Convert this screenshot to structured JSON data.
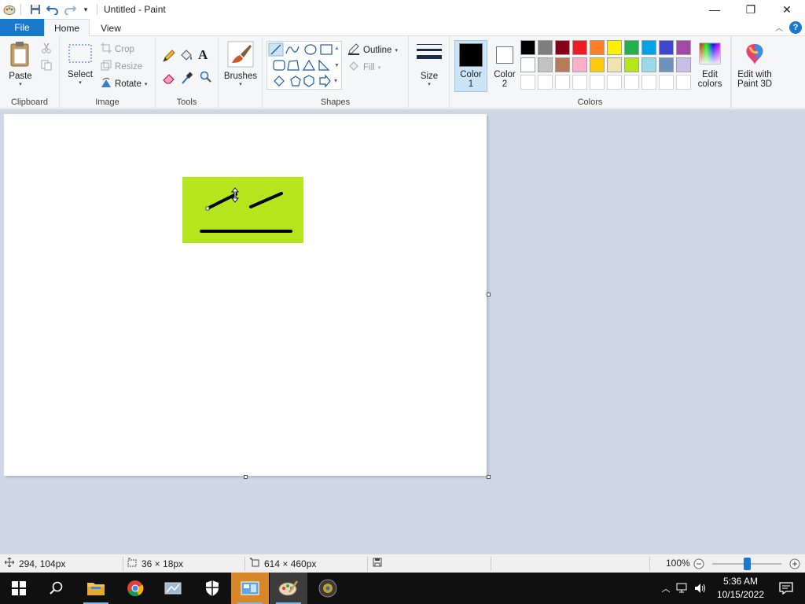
{
  "window": {
    "title": "Untitled - Paint",
    "minimize": "—",
    "maximize": "❐",
    "close": "✕"
  },
  "tabs": {
    "file": "File",
    "home": "Home",
    "view": "View"
  },
  "ribbon": {
    "clipboard": {
      "paste": "Paste",
      "label": "Clipboard"
    },
    "image": {
      "select": "Select",
      "crop": "Crop",
      "resize": "Resize",
      "rotate": "Rotate",
      "label": "Image"
    },
    "tools": {
      "label": "Tools"
    },
    "brushes": {
      "label": "Brushes"
    },
    "shapes": {
      "outline": "Outline",
      "fill": "Fill",
      "label": "Shapes"
    },
    "size": {
      "label": "Size"
    },
    "colors": {
      "color1": "Color",
      "color1_num": "1",
      "color2": "Color",
      "color2_num": "2",
      "edit_colors_1": "Edit",
      "edit_colors_2": "colors",
      "paint3d_1": "Edit with",
      "paint3d_2": "Paint 3D",
      "label": "Colors",
      "color1_value": "#000000",
      "color2_value": "#ffffff",
      "palette_row1": [
        "#000000",
        "#7f7f7f",
        "#880015",
        "#ed1c24",
        "#ff7f27",
        "#fff200",
        "#22b14c",
        "#00a2e8",
        "#3f48cc",
        "#a349a4"
      ],
      "palette_row2": [
        "#ffffff",
        "#c3c3c3",
        "#b97a57",
        "#ffaec9",
        "#ffc90e",
        "#efe4b0",
        "#b5e61d",
        "#99d9ea",
        "#7092be",
        "#c8bfe7"
      ]
    }
  },
  "canvas": {
    "shape_color": "#b5e61d",
    "stroke_color": "#000000"
  },
  "status": {
    "cursor_pos": "294, 104px",
    "selection_size": "36 × 18px",
    "canvas_size": "614 × 460px",
    "zoom": "100%"
  },
  "taskbar": {
    "time": "5:36 AM",
    "date": "10/15/2022"
  }
}
